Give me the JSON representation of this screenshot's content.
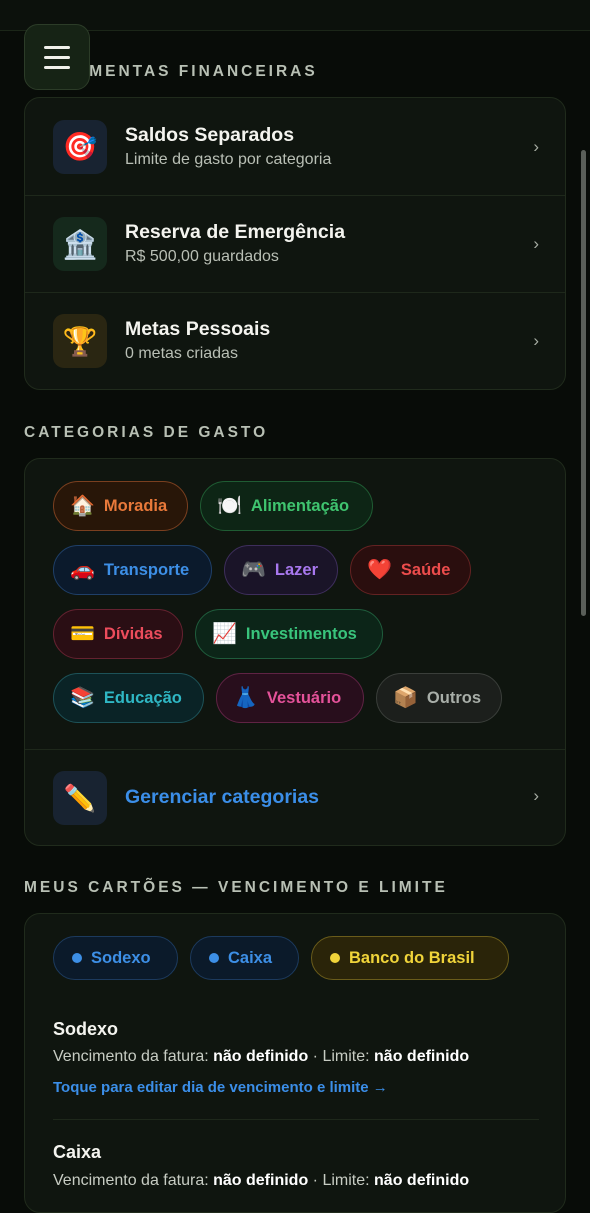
{
  "menu_button": {
    "icon": "hamburger-icon"
  },
  "sections": {
    "tools_title": "AMENTAS FINANCEIRAS",
    "categories_title": "CATEGORIAS DE GASTO",
    "cards_title": "MEUS CARTÕES — VENCIMENTO E LIMITE"
  },
  "tools": [
    {
      "title": "Saldos Separados",
      "subtitle": "Limite de gasto por categoria",
      "icon": "🎯",
      "icon_name": "target-icon",
      "chevron": "›"
    },
    {
      "title": "Reserva de Emergência",
      "subtitle": "R$ 500,00 guardados",
      "icon": "🏦",
      "icon_name": "bank-icon",
      "chevron": "›"
    },
    {
      "title": "Metas Pessoais",
      "subtitle": "0 metas criadas",
      "icon": "🏆",
      "icon_name": "trophy-icon",
      "chevron": "›"
    }
  ],
  "categories": [
    {
      "label": "Moradia",
      "emoji": "🏠",
      "color": "#e9793a"
    },
    {
      "label": "Alimentação",
      "emoji": "🍽️",
      "color": "#3fc46f"
    },
    {
      "label": "Transporte",
      "emoji": "🚗",
      "color": "#3d8fe6"
    },
    {
      "label": "Lazer",
      "emoji": "🎮",
      "color": "#a878ee"
    },
    {
      "label": "Saúde",
      "emoji": "❤️",
      "color": "#ec4c4c"
    },
    {
      "label": "Dívidas",
      "emoji": "💳",
      "color": "#ec4c5c"
    },
    {
      "label": "Investimentos",
      "emoji": "📈",
      "color": "#39c47c"
    },
    {
      "label": "Educação",
      "emoji": "📚",
      "color": "#2fb7c4"
    },
    {
      "label": "Vestuário",
      "emoji": "👗",
      "color": "#e5529a"
    },
    {
      "label": "Outros",
      "emoji": "📦",
      "color": "#9aa09a"
    }
  ],
  "manage": {
    "label": "Gerenciar categorias",
    "icon": "✏️",
    "icon_name": "pencil-icon",
    "chevron": "›"
  },
  "card_tabs": [
    {
      "label": "Sodexo",
      "color": "#3d8fe6",
      "active": false
    },
    {
      "label": "Caixa",
      "color": "#3d8fe6",
      "active": false
    },
    {
      "label": "Banco do Brasil",
      "color": "#f0d43a",
      "active": true
    }
  ],
  "cards": [
    {
      "name": "Sodexo",
      "due_label": "Vencimento da fatura:",
      "due_value": "não definido",
      "limit_label": "· Limite:",
      "limit_value": "não definido",
      "edit_link": "Toque para editar dia de vencimento e limite →"
    },
    {
      "name": "Caixa",
      "due_label": "Vencimento da fatura:",
      "due_value": "não definido",
      "limit_label": "· Limite:",
      "limit_value": "não definido"
    }
  ]
}
